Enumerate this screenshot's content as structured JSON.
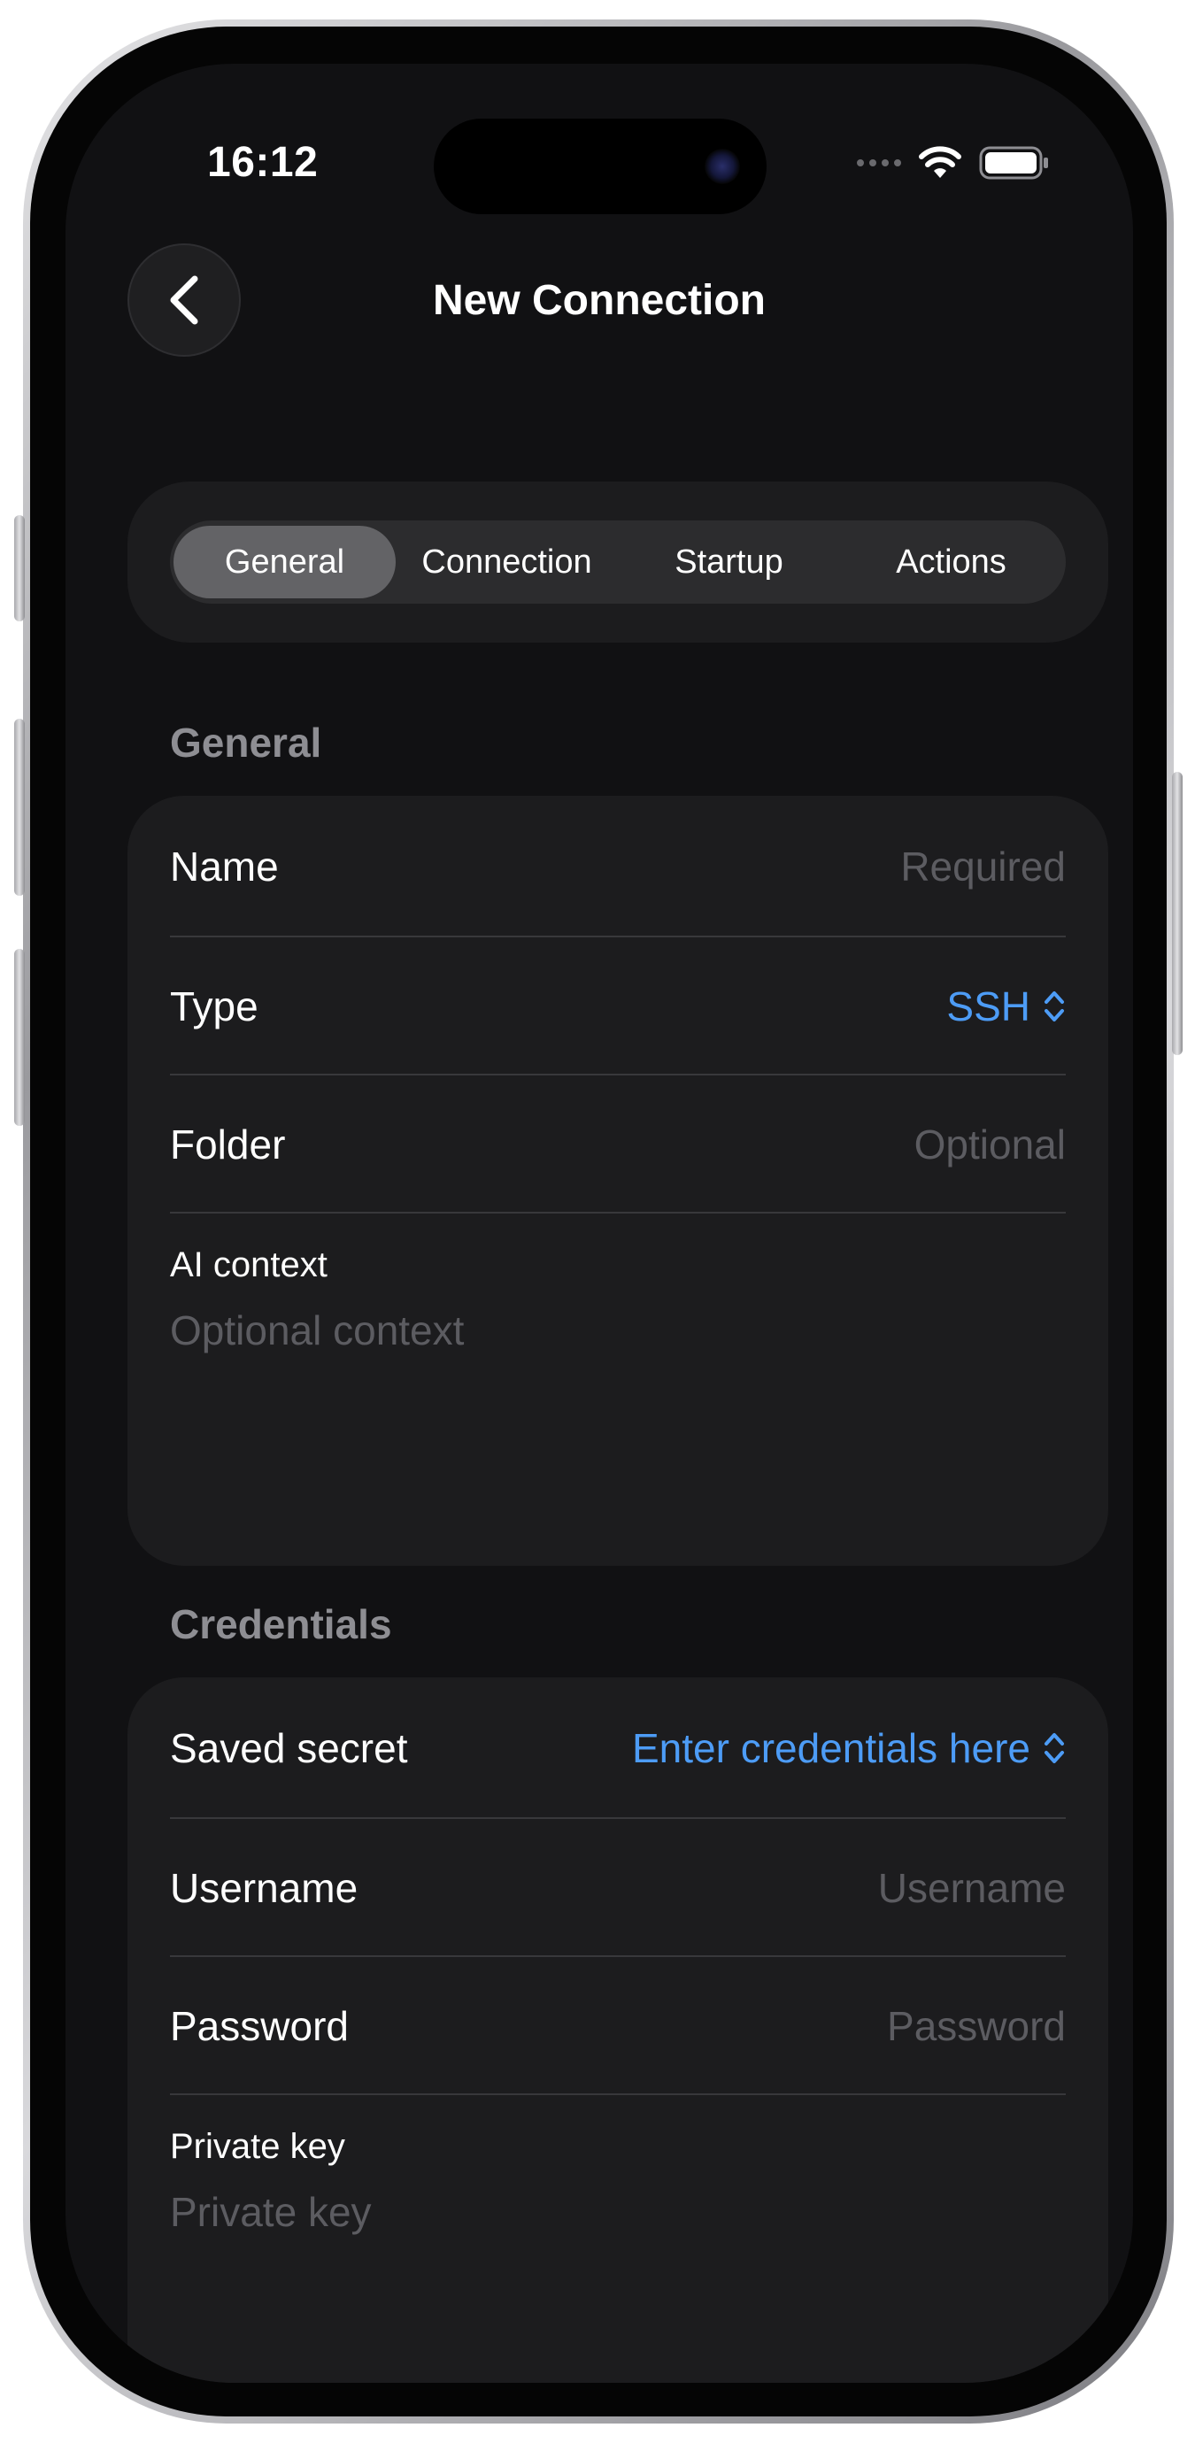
{
  "status_bar": {
    "time": "16:12"
  },
  "nav": {
    "title": "New Connection"
  },
  "tabs": [
    {
      "label": "General",
      "active": true
    },
    {
      "label": "Connection",
      "active": false
    },
    {
      "label": "Startup",
      "active": false
    },
    {
      "label": "Actions",
      "active": false
    }
  ],
  "general": {
    "header": "General",
    "name": {
      "label": "Name",
      "placeholder": "Required"
    },
    "type": {
      "label": "Type",
      "value": "SSH"
    },
    "folder": {
      "label": "Folder",
      "placeholder": "Optional"
    },
    "ai_context": {
      "label": "AI context",
      "placeholder": "Optional context"
    }
  },
  "credentials": {
    "header": "Credentials",
    "saved_secret": {
      "label": "Saved secret",
      "value": "Enter credentials here"
    },
    "username": {
      "label": "Username",
      "placeholder": "Username"
    },
    "password": {
      "label": "Password",
      "placeholder": "Password"
    },
    "private_key": {
      "label": "Private key",
      "placeholder": "Private key"
    }
  },
  "colors": {
    "background": "#111113",
    "card": "#1c1c1e",
    "accent": "#4d9cf6",
    "placeholder": "#5c5c61",
    "section_header": "#8e8e93"
  }
}
